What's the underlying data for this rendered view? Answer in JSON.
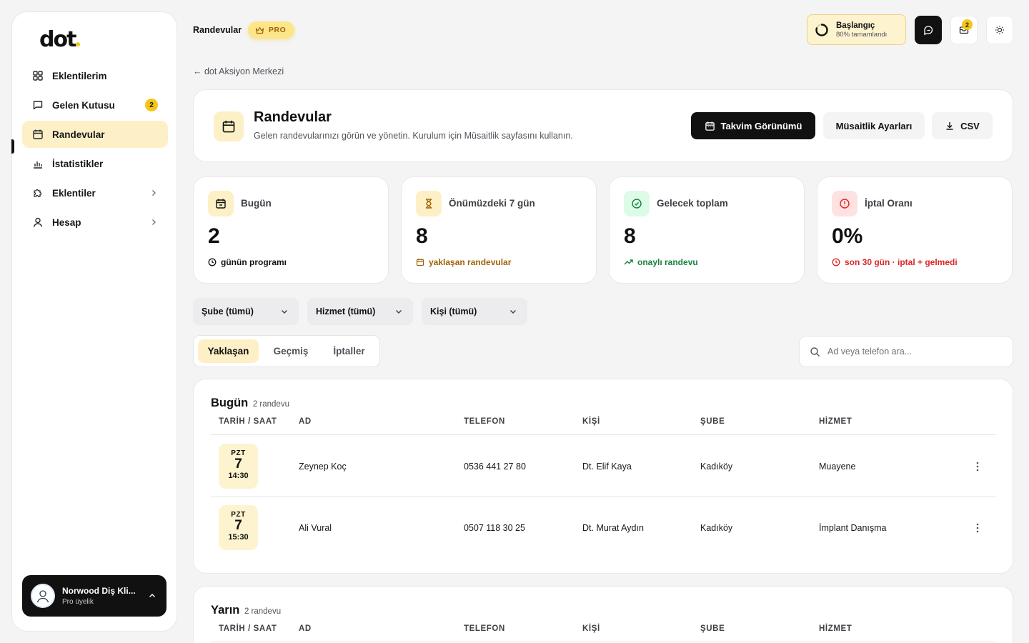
{
  "brand": {
    "logo_text": "dot",
    "accent": "#f5c518"
  },
  "sidebar": {
    "items": [
      {
        "label": "Eklentilerim",
        "icon": "grid-icon"
      },
      {
        "label": "Gelen Kutusu",
        "icon": "message-icon",
        "badge": "2"
      },
      {
        "label": "Randevular",
        "icon": "calendar-icon",
        "active": true
      },
      {
        "label": "İstatistikler",
        "icon": "bar-chart-icon"
      },
      {
        "label": "Eklentiler",
        "icon": "puzzle-icon"
      },
      {
        "label": "Hesap",
        "icon": "user-icon"
      }
    ],
    "account": {
      "name": "Norwood Diş Kli...",
      "plan": "Pro üyelik"
    }
  },
  "topbar": {
    "title": "Randevular",
    "pro_label": "PRO",
    "progress": {
      "title": "Başlangıç",
      "subtitle": "80% tamamlandı",
      "value": 0.8
    },
    "mail_badge": "2"
  },
  "breadcrumb": "← dot Aksiyon Merkezi",
  "header": {
    "title": "Randevular",
    "subtitle": "Gelen randevularınızı görün ve yönetin. Kurulum için Müsaitlik sayfasını kullanın.",
    "buttons": {
      "calendar": "Takvim Görünümü",
      "availability": "Müsaitlik Ayarları",
      "csv": "CSV"
    }
  },
  "stats": [
    {
      "label": "Bugün",
      "value": "2",
      "footer": "günün programı",
      "color": "#111111"
    },
    {
      "label": "Önümüzdeki 7 gün",
      "value": "8",
      "footer": "yaklaşan randevular",
      "color": "#a16207"
    },
    {
      "label": "Gelecek toplam",
      "value": "8",
      "footer": "onaylı randevu",
      "color": "#15803d"
    },
    {
      "label": "İptal Oranı",
      "value": "0%",
      "footer": "son 30 gün · iptal + gelmedi",
      "color": "#dc2626"
    }
  ],
  "filters": {
    "branch": "Şube (tümü)",
    "service": "Hizmet (tümü)",
    "person": "Kişi (tümü)"
  },
  "tabs": [
    "Yaklaşan",
    "Geçmiş",
    "İptaller"
  ],
  "search": {
    "placeholder": "Ad veya telefon ara...",
    "value": ""
  },
  "columns": [
    "TARİH / SAAT",
    "AD",
    "TELEFON",
    "KİŞİ",
    "ŞUBE",
    "HİZMET"
  ],
  "sections": [
    {
      "title": "Bugün",
      "count": "2 randevu",
      "rows": [
        {
          "day": "PZT",
          "date": "7",
          "time": "14:30",
          "name": "Zeynep Koç",
          "phone": "0536 441 27 80",
          "person": "Dt. Elif Kaya",
          "branch": "Kadıköy",
          "service": "Muayene"
        },
        {
          "day": "PZT",
          "date": "7",
          "time": "15:30",
          "name": "Ali Vural",
          "phone": "0507 118 30 25",
          "person": "Dt. Murat Aydın",
          "branch": "Kadıköy",
          "service": "İmplant Danışma"
        }
      ]
    },
    {
      "title": "Yarın",
      "count": "2 randevu",
      "rows": []
    }
  ]
}
